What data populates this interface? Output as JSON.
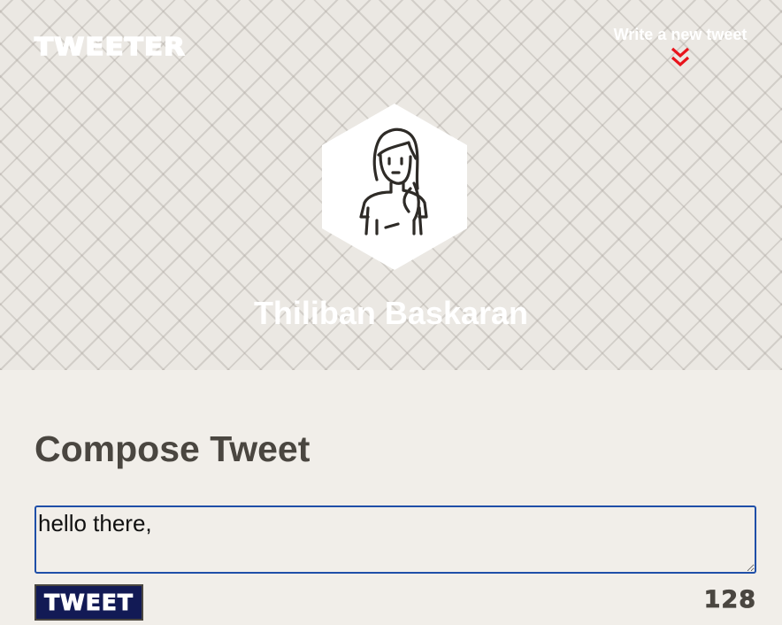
{
  "nav": {
    "logo": "TWEETER",
    "write_link": "Write a new tweet",
    "write_icon": "double-chevron-down-icon",
    "accent_color": "#e8141c"
  },
  "profile": {
    "avatar_icon": "woman-avatar-icon",
    "name": "Thiliban Baskaran"
  },
  "compose": {
    "title": "Compose Tweet",
    "input_value": "hello there,",
    "button_label": "TWEET",
    "button_color": "#121a55",
    "counter": "128"
  }
}
